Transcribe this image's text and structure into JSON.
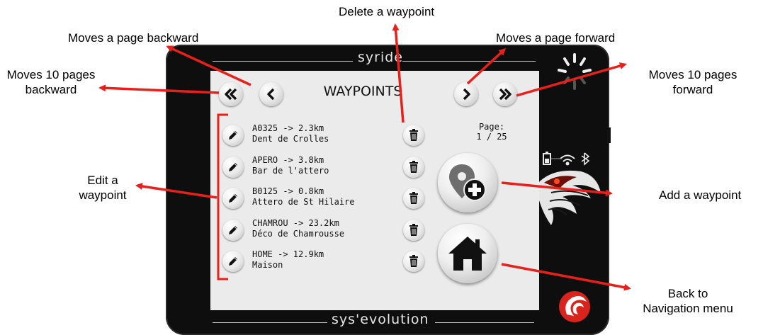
{
  "device": {
    "brand_top": "syride",
    "brand_bottom": "sys'evolution"
  },
  "screen": {
    "title": "WAYPOINTS",
    "page_label": "Page:",
    "page_value": "1 / 25",
    "waypoints": [
      {
        "line1": "A0325 -> 2.3km",
        "line2": "Dent de Crolles"
      },
      {
        "line1": "APERO -> 3.8km",
        "line2": "Bar de l'attero"
      },
      {
        "line1": "B0125 -> 0.8km",
        "line2": "Attero de St Hilaire"
      },
      {
        "line1": "CHAMROU -> 23.2km",
        "line2": "Déco de Chamrousse"
      },
      {
        "line1": "HOME -> 12.9km",
        "line2": "Maison"
      }
    ]
  },
  "annotations": {
    "delete": "Delete a waypoint",
    "page_backward": "Moves a page backward",
    "page_forward": "Moves a page forward",
    "ten_back_1": "Moves 10 pages",
    "ten_back_2": "backward",
    "ten_forward_1": "Moves 10 pages",
    "ten_forward_2": "forward",
    "edit_1": "Edit a",
    "edit_2": "waypoint",
    "add": "Add a waypoint",
    "home_1": "Back to",
    "home_2": "Navigation menu"
  },
  "colors": {
    "arrow": "#e8201b",
    "device": "#0e0e0e",
    "screen": "#ebebeb",
    "logo_red": "#d9231d"
  },
  "icons": [
    "double-chevron-left-icon",
    "chevron-left-icon",
    "chevron-right-icon",
    "double-chevron-right-icon",
    "pencil-icon",
    "trash-icon",
    "map-pin-add-icon",
    "home-icon",
    "gps-fix-icon",
    "battery-icon",
    "wifi-icon",
    "bluetooth-icon",
    "eagle-logo",
    "syride-logo"
  ]
}
